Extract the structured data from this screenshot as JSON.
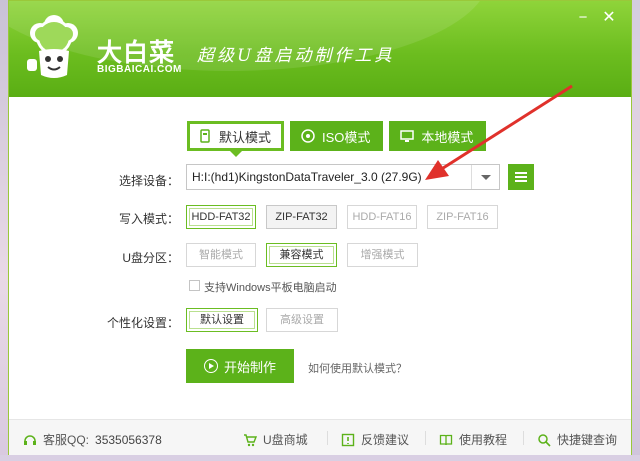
{
  "window": {
    "brand_name": "大白菜",
    "brand_url": "BIGBAICAI.COM",
    "slogan": "超级U盘启动制作工具",
    "minimize_label": "−",
    "close_label": "✕"
  },
  "tabs": [
    {
      "label": "默认模式",
      "icon": "usb-drive-icon",
      "active": true
    },
    {
      "label": "ISO模式",
      "icon": "disc-icon",
      "active": false
    },
    {
      "label": "本地模式",
      "icon": "monitor-icon",
      "active": false
    }
  ],
  "device": {
    "label": "选择设备：",
    "value": "H:I:(hd1)KingstonDataTraveler_3.0 (27.9G)"
  },
  "write_mode": {
    "label": "写入模式：",
    "options": [
      "HDD-FAT32",
      "ZIP-FAT32",
      "HDD-FAT16",
      "ZIP-FAT16"
    ],
    "selected": "HDD-FAT32"
  },
  "partition": {
    "label": "U盘分区：",
    "options": [
      "智能模式",
      "兼容模式",
      "增强模式"
    ],
    "selected": "兼容模式"
  },
  "tablet_boot": {
    "label": "支持Windows平板电脑启动",
    "checked": false
  },
  "personalize": {
    "label": "个性化设置：",
    "options": [
      "默认设置",
      "高级设置"
    ],
    "selected": "默认设置"
  },
  "start_button": "开始制作",
  "help_link": "如何使用默认模式？",
  "footer": {
    "qq_label": "客服QQ:",
    "qq_number": "3535056378",
    "mall": "U盘商城",
    "feedback": "反馈建议",
    "tutorial": "使用教程",
    "shortcut": "快捷键查询"
  },
  "colors": {
    "brand_green": "#5cb21a",
    "annotation_red": "#e0312b"
  }
}
